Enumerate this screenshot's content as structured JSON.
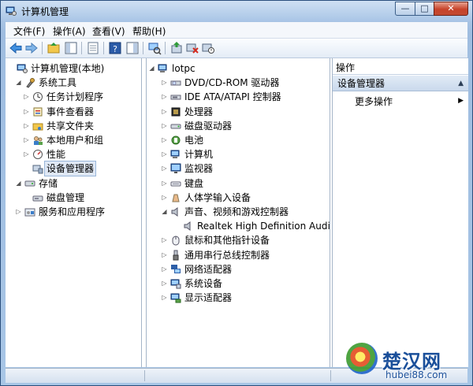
{
  "window": {
    "title": "计算机管理"
  },
  "titlebar_buttons": {
    "minimize": "—",
    "maximize": "□",
    "close": "✕"
  },
  "menu": [
    "文件(F)",
    "操作(A)",
    "查看(V)",
    "帮助(H)"
  ],
  "left_tree": [
    {
      "label": "计算机管理(本地)",
      "level": 0,
      "expander": "",
      "icon": "computer-management-icon"
    },
    {
      "label": "系统工具",
      "level": 1,
      "expander": "◢",
      "icon": "system-tools-icon"
    },
    {
      "label": "任务计划程序",
      "level": 2,
      "expander": "▷",
      "icon": "task-scheduler-icon"
    },
    {
      "label": "事件查看器",
      "level": 2,
      "expander": "▷",
      "icon": "event-viewer-icon"
    },
    {
      "label": "共享文件夹",
      "level": 2,
      "expander": "▷",
      "icon": "shared-folders-icon"
    },
    {
      "label": "本地用户和组",
      "level": 2,
      "expander": "▷",
      "icon": "local-users-icon"
    },
    {
      "label": "性能",
      "level": 2,
      "expander": "▷",
      "icon": "performance-icon"
    },
    {
      "label": "设备管理器",
      "level": 2,
      "expander": "",
      "icon": "device-manager-icon",
      "selected": true
    },
    {
      "label": "存储",
      "level": 1,
      "expander": "◢",
      "icon": "storage-icon"
    },
    {
      "label": "磁盘管理",
      "level": 2,
      "expander": "",
      "icon": "disk-management-icon"
    },
    {
      "label": "服务和应用程序",
      "level": 1,
      "expander": "▷",
      "icon": "services-apps-icon"
    }
  ],
  "device_tree": [
    {
      "label": "lotpc",
      "level": 0,
      "expander": "◢",
      "icon": "computer-icon"
    },
    {
      "label": "DVD/CD-ROM 驱动器",
      "level": 1,
      "expander": "▷",
      "icon": "dvd-drive-icon"
    },
    {
      "label": "IDE ATA/ATAPI 控制器",
      "level": 1,
      "expander": "▷",
      "icon": "ide-controller-icon"
    },
    {
      "label": "处理器",
      "level": 1,
      "expander": "▷",
      "icon": "processor-icon"
    },
    {
      "label": "磁盘驱动器",
      "level": 1,
      "expander": "▷",
      "icon": "disk-drive-icon"
    },
    {
      "label": "电池",
      "level": 1,
      "expander": "▷",
      "icon": "battery-icon"
    },
    {
      "label": "计算机",
      "level": 1,
      "expander": "▷",
      "icon": "computer-icon"
    },
    {
      "label": "监视器",
      "level": 1,
      "expander": "▷",
      "icon": "monitor-icon"
    },
    {
      "label": "键盘",
      "level": 1,
      "expander": "▷",
      "icon": "keyboard-icon"
    },
    {
      "label": "人体学输入设备",
      "level": 1,
      "expander": "▷",
      "icon": "hid-icon"
    },
    {
      "label": "声音、视频和游戏控制器",
      "level": 1,
      "expander": "◢",
      "icon": "sound-icon"
    },
    {
      "label": "Realtek High Definition Audio",
      "level": 2,
      "expander": "",
      "icon": "speaker-icon"
    },
    {
      "label": "鼠标和其他指针设备",
      "level": 1,
      "expander": "▷",
      "icon": "mouse-icon"
    },
    {
      "label": "通用串行总线控制器",
      "level": 1,
      "expander": "▷",
      "icon": "usb-icon"
    },
    {
      "label": "网络适配器",
      "level": 1,
      "expander": "▷",
      "icon": "network-adapter-icon"
    },
    {
      "label": "系统设备",
      "level": 1,
      "expander": "▷",
      "icon": "system-device-icon"
    },
    {
      "label": "显示适配器",
      "level": 1,
      "expander": "▷",
      "icon": "display-adapter-icon"
    }
  ],
  "actions": {
    "header": "操作",
    "section": "设备管理器",
    "collapse_icon": "▲",
    "more": "更多操作",
    "more_arrow": "▶"
  },
  "watermark": {
    "text": "楚汉网",
    "url": "hubei88.com"
  }
}
